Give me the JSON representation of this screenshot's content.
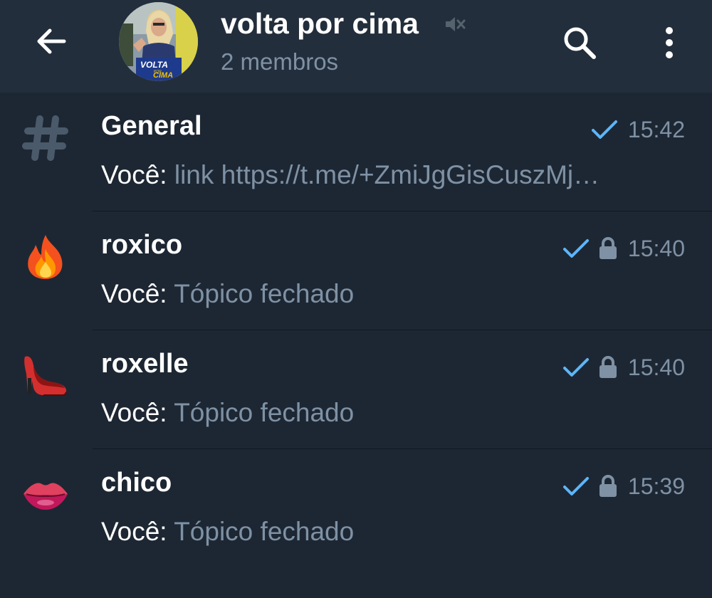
{
  "header": {
    "back_icon": "arrow-left-icon",
    "title": "volta por cima",
    "muted_icon": "muted-speaker-icon",
    "subtitle": "2 membros",
    "search_icon": "search-icon",
    "menu_icon": "more-vertical-icon",
    "avatar_text_top": "VOLTA",
    "avatar_text_mid": "POR",
    "avatar_text_bottom": "CIMA"
  },
  "topics": [
    {
      "name": "General",
      "icon": "hash-icon",
      "time": "15:42",
      "sent_check": true,
      "locked": false,
      "sender": "Você:",
      "message": "link https://t.me/+ZmiJgGisCuszMj…"
    },
    {
      "name": "roxico",
      "icon": "fire-icon",
      "time": "15:40",
      "sent_check": true,
      "locked": true,
      "sender": "Você:",
      "message": "Tópico fechado"
    },
    {
      "name": "roxelle",
      "icon": "high-heel-icon",
      "time": "15:40",
      "sent_check": true,
      "locked": true,
      "sender": "Você:",
      "message": "Tópico fechado"
    },
    {
      "name": "chico",
      "icon": "lips-icon",
      "time": "15:39",
      "sent_check": true,
      "locked": true,
      "sender": "Você:",
      "message": "Tópico fechado"
    }
  ],
  "colors": {
    "background": "#1d2733",
    "header": "#232e3c",
    "secondary_text": "#7f91a4",
    "check": "#5eb5f7"
  }
}
